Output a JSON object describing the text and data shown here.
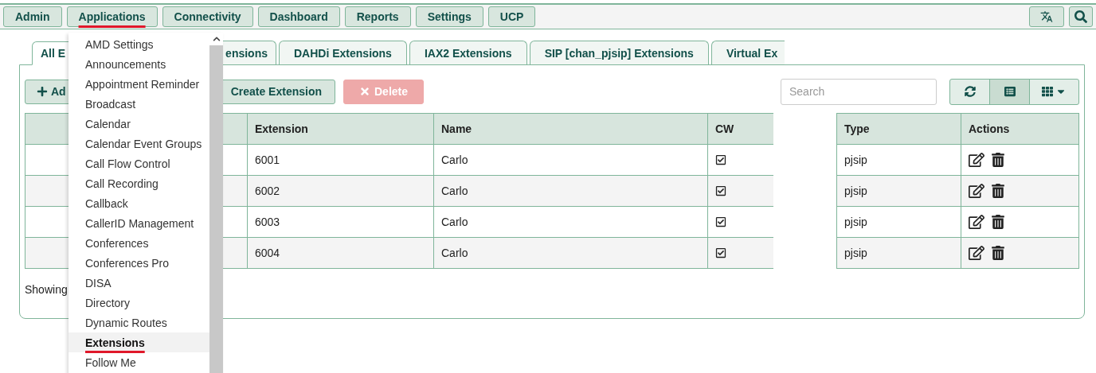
{
  "nav": {
    "items": [
      {
        "label": "Admin",
        "selected": false
      },
      {
        "label": "Applications",
        "selected": true
      },
      {
        "label": "Connectivity",
        "selected": false
      },
      {
        "label": "Dashboard",
        "selected": false
      },
      {
        "label": "Reports",
        "selected": false
      },
      {
        "label": "Settings",
        "selected": false
      },
      {
        "label": "UCP",
        "selected": false
      }
    ]
  },
  "applications_menu": {
    "items": [
      {
        "label": "AMD Settings",
        "selected": false
      },
      {
        "label": "Announcements",
        "selected": false
      },
      {
        "label": "Appointment Reminder",
        "selected": false
      },
      {
        "label": "Broadcast",
        "selected": false
      },
      {
        "label": "Calendar",
        "selected": false
      },
      {
        "label": "Calendar Event Groups",
        "selected": false
      },
      {
        "label": "Call Flow Control",
        "selected": false
      },
      {
        "label": "Call Recording",
        "selected": false
      },
      {
        "label": "Callback",
        "selected": false
      },
      {
        "label": "CallerID Management",
        "selected": false
      },
      {
        "label": "Conferences",
        "selected": false
      },
      {
        "label": "Conferences Pro",
        "selected": false
      },
      {
        "label": "DISA",
        "selected": false
      },
      {
        "label": "Directory",
        "selected": false
      },
      {
        "label": "Dynamic Routes",
        "selected": false
      },
      {
        "label": "Extensions",
        "selected": true
      },
      {
        "label": "Follow Me",
        "selected": false
      }
    ]
  },
  "tabs": [
    {
      "label": "All E",
      "selected": true
    },
    {
      "label": "ensions",
      "selected": false
    },
    {
      "label": "DAHDi Extensions",
      "selected": false
    },
    {
      "label": "IAX2 Extensions",
      "selected": false
    },
    {
      "label": "SIP [chan_pjsip] Extensions",
      "selected": false
    },
    {
      "label": "Virtual Ex",
      "selected": false
    }
  ],
  "toolbar": {
    "add_label": "Ad",
    "create_label": "Create Extension",
    "delete_label": "Delete",
    "delete_disabled": true,
    "search": {
      "placeholder": "Search"
    },
    "views": [
      {
        "kind": "refresh",
        "selected": false
      },
      {
        "kind": "list",
        "selected": true
      },
      {
        "kind": "grid",
        "selected": false
      }
    ]
  },
  "table": {
    "columns": [
      "Extension",
      "Name",
      "CW",
      "Type",
      "Actions"
    ],
    "rows": [
      {
        "extension": "6001",
        "name": "Carlo",
        "cw": true,
        "type": "pjsip"
      },
      {
        "extension": "6002",
        "name": "Carlo",
        "cw": true,
        "type": "pjsip"
      },
      {
        "extension": "6003",
        "name": "Carlo",
        "cw": true,
        "type": "pjsip"
      },
      {
        "extension": "6004",
        "name": "Carlo",
        "cw": true,
        "type": "pjsip"
      }
    ]
  },
  "footer": {
    "showing": "Showing"
  }
}
